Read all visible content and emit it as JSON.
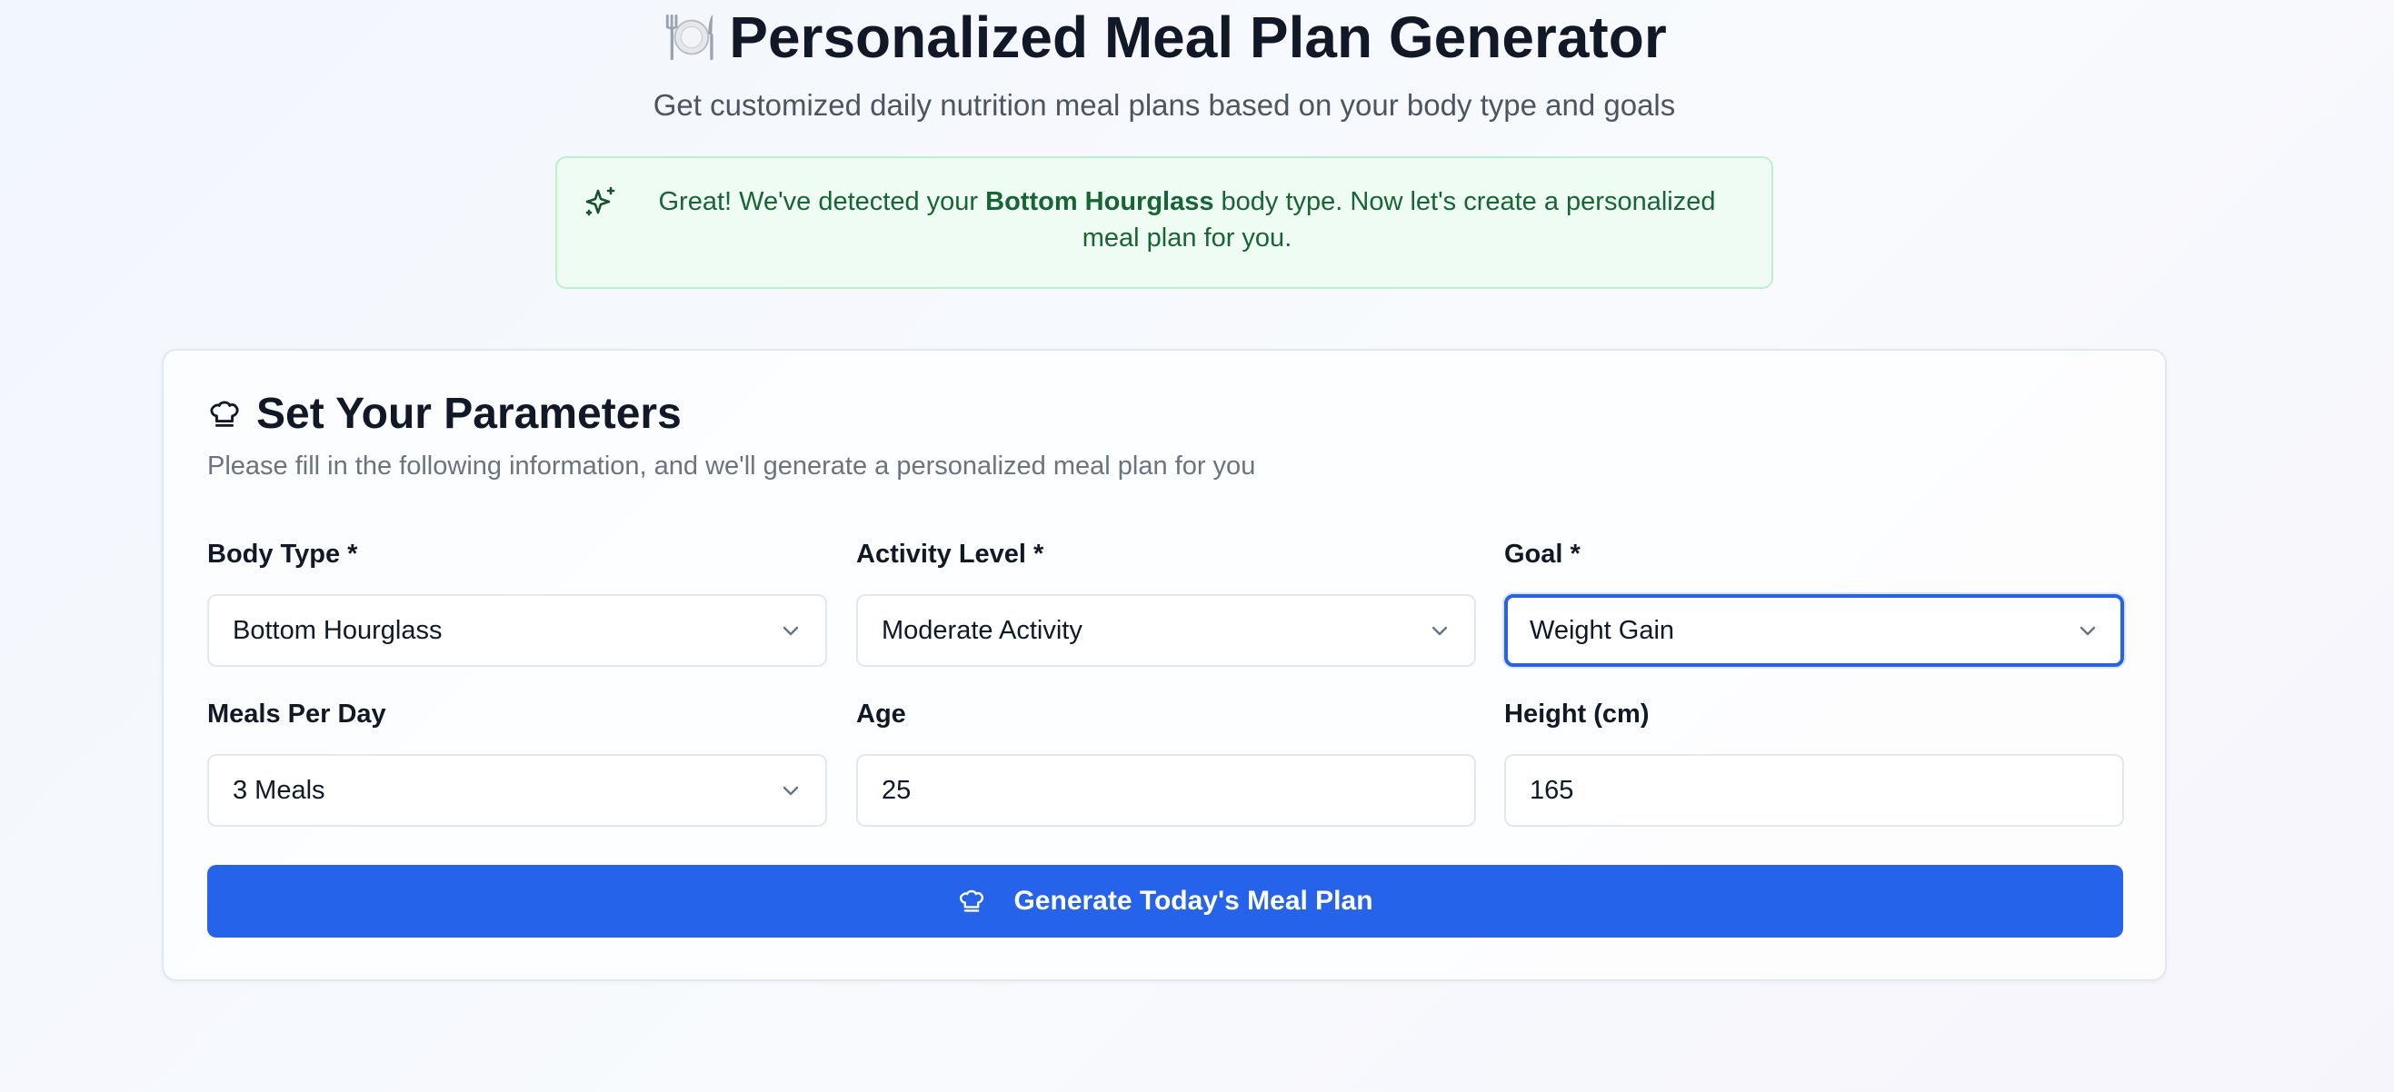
{
  "header": {
    "title": "Personalized Meal Plan Generator",
    "title_icon": "plate-cutlery-icon",
    "subtitle": "Get customized daily nutrition meal plans based on your body type and goals"
  },
  "alert": {
    "icon": "sparkle-icon",
    "text_before": "Great! We've detected your ",
    "body_type": "Bottom Hourglass",
    "text_after": " body type. Now let's create a personalized meal plan for you.",
    "colors": {
      "background": "#effcf3",
      "border": "#bbf2cc",
      "text": "#166534"
    }
  },
  "form": {
    "title": "Set Your Parameters",
    "title_icon": "chef-hat-icon",
    "description": "Please fill in the following information, and we'll generate a personalized meal plan for you",
    "fields": {
      "body_type": {
        "label": "Body Type *",
        "value": "Bottom Hourglass"
      },
      "activity_level": {
        "label": "Activity Level *",
        "value": "Moderate Activity"
      },
      "goal": {
        "label": "Goal *",
        "value": "Weight Gain"
      },
      "meals_per_day": {
        "label": "Meals Per Day",
        "value": "3 Meals"
      },
      "age": {
        "label": "Age",
        "value": "25"
      },
      "height": {
        "label": "Height (cm)",
        "value": "165"
      }
    },
    "submit_label": "Generate Today's Meal Plan",
    "submit_icon": "chef-hat-icon"
  },
  "colors": {
    "accent": "#2563eb",
    "text": "#111827",
    "muted": "#6b7280"
  }
}
